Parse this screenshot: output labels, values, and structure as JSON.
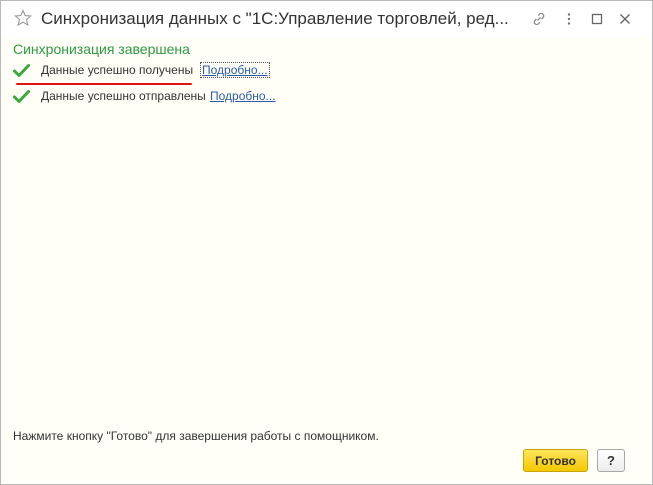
{
  "window": {
    "title": "Синхронизация данных с \"1С:Управление торговлей, ред..."
  },
  "status": {
    "heading": "Синхронизация завершена",
    "heading_color": "#2e9a44",
    "items": [
      {
        "label": "Данные успешно получены",
        "link": "Подробно..."
      },
      {
        "label": "Данные успешно отправлены",
        "link": "Подробно..."
      }
    ]
  },
  "footer": {
    "hint": "Нажмите кнопку \"Готово\" для завершения работы с помощником.",
    "done_label": "Готово",
    "help_label": "?"
  },
  "icons": {
    "favorite": "star-icon",
    "link": "link-icon",
    "more": "more-icon",
    "maximize": "maximize-icon",
    "close": "close-icon",
    "success": "checkmark-icon"
  }
}
